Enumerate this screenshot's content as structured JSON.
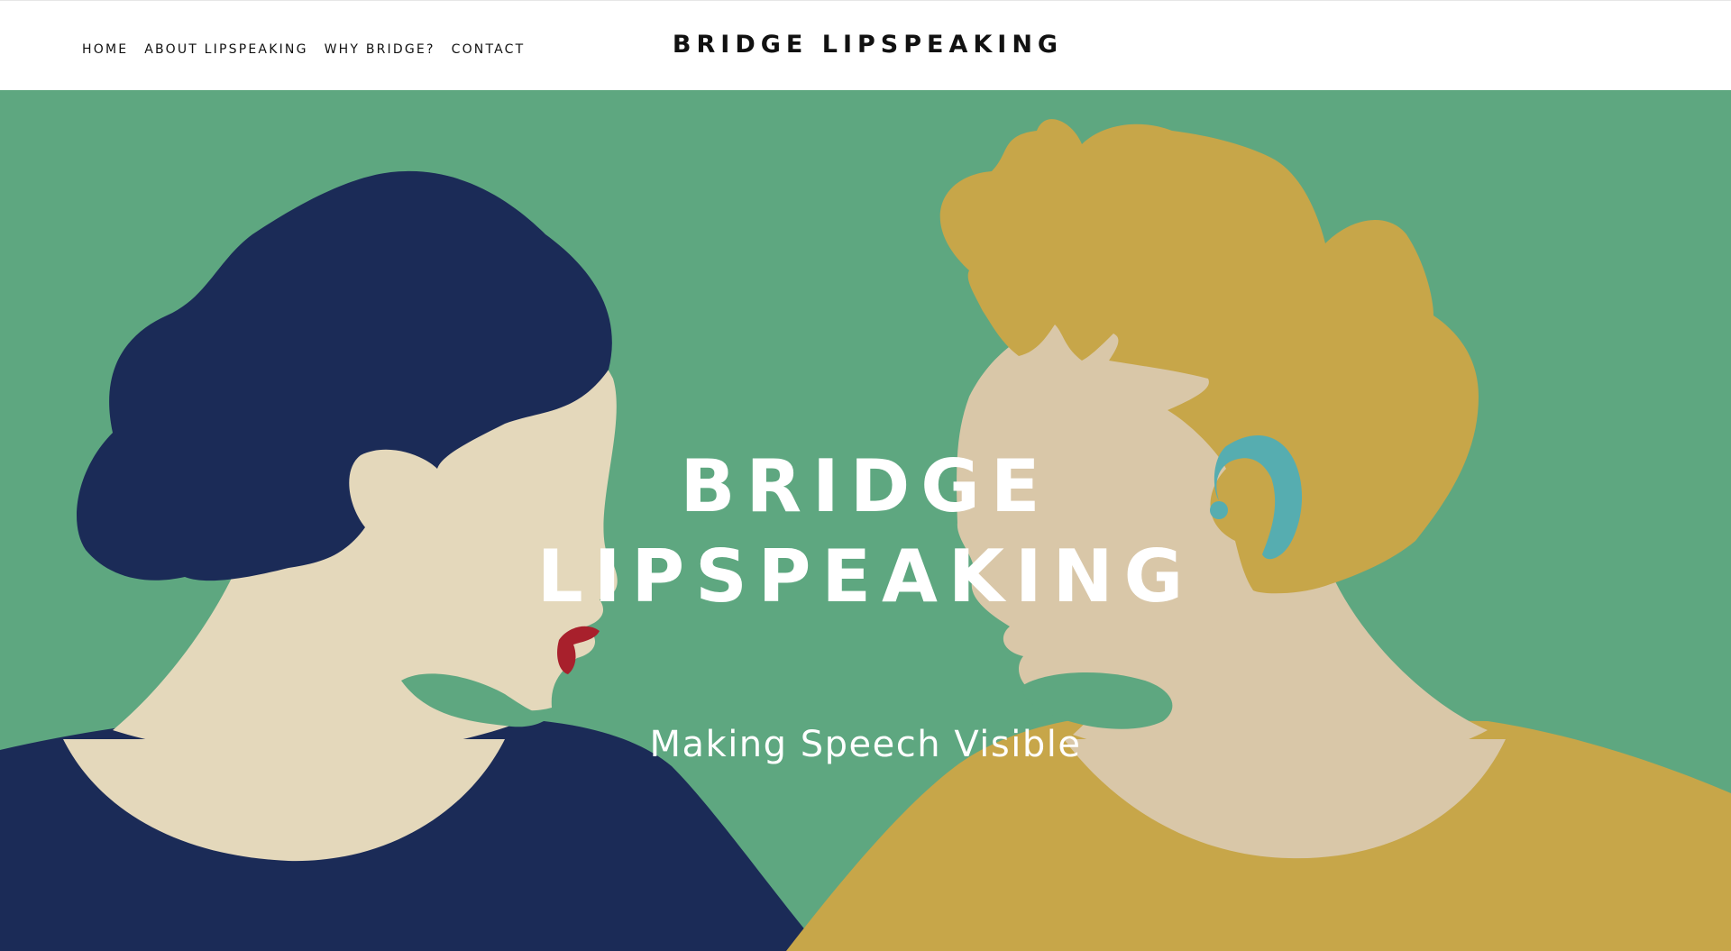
{
  "nav": {
    "items": [
      {
        "label": "HOME"
      },
      {
        "label": "ABOUT LIPSPEAKING"
      },
      {
        "label": "WHY BRIDGE?"
      },
      {
        "label": "CONTACT"
      }
    ]
  },
  "site_title": "BRIDGE LIPSPEAKING",
  "hero": {
    "title_line1": "BRIDGE",
    "title_line2": "LIPSPEAKING",
    "tagline": "Making Speech Visible"
  },
  "colors": {
    "background_green": "#5ea780",
    "navy": "#1b2b57",
    "gold": "#c7a649",
    "skin_left": "#e4d8bb",
    "skin_right": "#d9c7a8",
    "lips": "#a8202c",
    "hearing_aid": "#56adb0"
  }
}
